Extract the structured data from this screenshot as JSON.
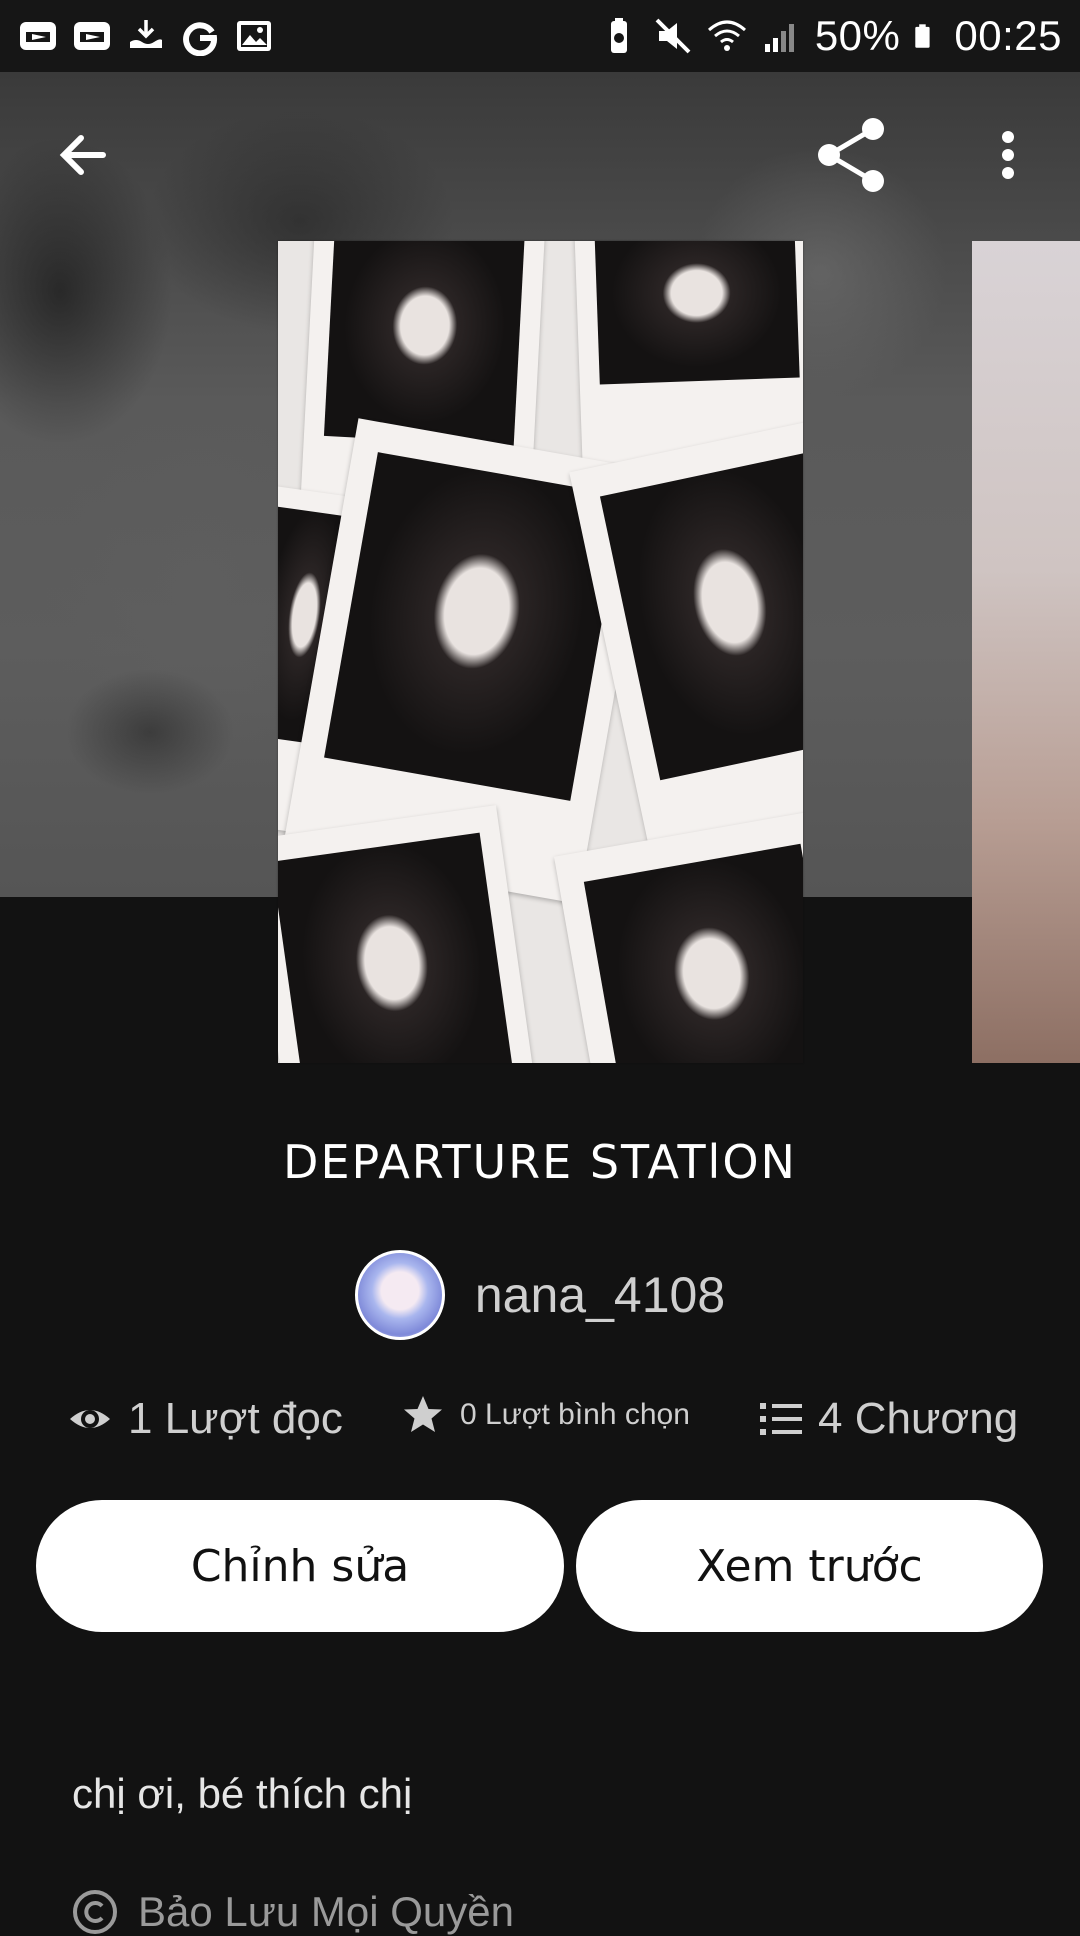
{
  "status_bar": {
    "battery": "50%",
    "time": "00:25",
    "left_icons": [
      "screen-cast-icon",
      "screen-cast-icon-2",
      "download-icon",
      "google-icon",
      "image-icon"
    ],
    "right_icons": [
      "battery-saver-icon",
      "mute-icon",
      "wifi-icon",
      "signal-icon",
      "battery-icon"
    ]
  },
  "header": {
    "back_icon": "arrow-left-icon",
    "share_icon": "share-icon",
    "menu_icon": "more-vertical-icon"
  },
  "story": {
    "title": "DEPARTURE STATlON",
    "author": "nana_4108",
    "stats": {
      "reads": "1 Lượt đọc",
      "votes": "0 Lượt bình chọn",
      "chapters": "4 Chương"
    },
    "buttons": {
      "edit": "Chỉnh sửa",
      "preview": "Xem trước"
    },
    "description": "chị ơi, bé thích chị",
    "rights": "Bảo Lưu Mọi Quyền"
  },
  "colors": {
    "background": "#121212",
    "button_bg": "#ffffff",
    "button_text": "#111111",
    "muted_text": "#cfcfcf"
  }
}
